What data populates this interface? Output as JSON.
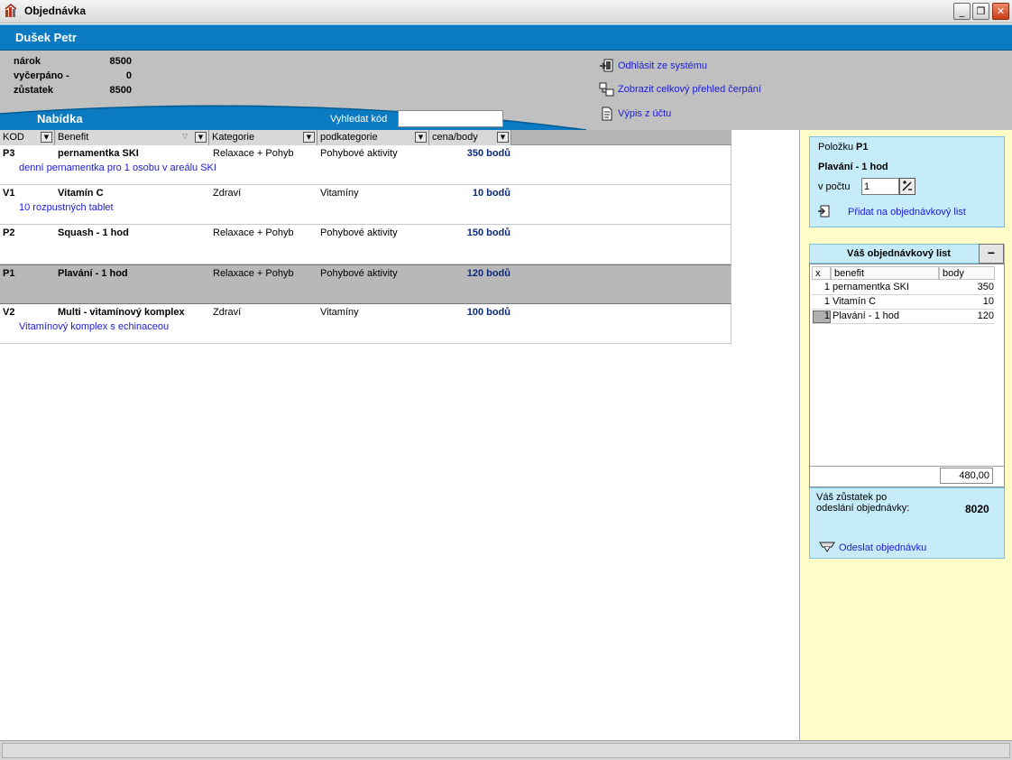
{
  "window": {
    "title": "Objednávka",
    "min": "_",
    "max": "❐",
    "close": "✕"
  },
  "user": {
    "name": "Dušek Petr"
  },
  "stats": [
    {
      "label": "nárok",
      "value": "8500"
    },
    {
      "label": "vyčerpáno  -",
      "value": "0"
    },
    {
      "label": "zůstatek",
      "value": "8500"
    }
  ],
  "actions": [
    {
      "label": "Odhlásit ze systému",
      "icon": "logout-icon"
    },
    {
      "label": "Zobrazit celkový přehled čerpání",
      "icon": "overview-icon"
    },
    {
      "label": "Výpis z účtu",
      "icon": "document-icon"
    }
  ],
  "offer": {
    "title": "Nabídka",
    "search_label": "Vyhledat kód",
    "search_value": ""
  },
  "grid": {
    "columns": [
      "KOD",
      "Benefit",
      "Kategorie",
      "podkategorie",
      "cena/body"
    ],
    "rows": [
      {
        "kod": "P3",
        "name": "pernamentka SKI",
        "kategorie": "Relaxace + Pohyb",
        "podkategorie": "Pohybové aktivity",
        "cena": "350 bodů",
        "desc": "denní pernamentka pro 1 osobu v areálu SKI",
        "selected": false
      },
      {
        "kod": "V1",
        "name": "Vitamín C",
        "kategorie": "Zdraví",
        "podkategorie": "Vitamíny",
        "cena": "10 bodů",
        "desc": "10  rozpustných tablet",
        "selected": false
      },
      {
        "kod": "P2",
        "name": "Squash - 1 hod",
        "kategorie": "Relaxace + Pohyb",
        "podkategorie": "Pohybové aktivity",
        "cena": "150 bodů",
        "desc": "",
        "selected": false
      },
      {
        "kod": "P1",
        "name": "Plavání - 1 hod",
        "kategorie": "Relaxace + Pohyb",
        "podkategorie": "Pohybové aktivity",
        "cena": "120 bodů",
        "desc": "",
        "selected": true
      },
      {
        "kod": "V2",
        "name": "Multi - vitamínový komplex",
        "kategorie": "Zdraví",
        "podkategorie": "Vitamíny",
        "cena": "100 bodů",
        "desc": "Vitamínový komplex s echinaceou",
        "selected": false
      }
    ]
  },
  "item_panel": {
    "label": "Položku",
    "code": "P1",
    "name": "Plavání - 1 hod",
    "qty_label": "v počtu",
    "qty_value": "1",
    "add_label": "Přidat na objednávkový list"
  },
  "order": {
    "title": "Váš objednávkový list",
    "minus": "−",
    "headers": [
      "x",
      "benefit",
      "body"
    ],
    "rows": [
      {
        "q": "1",
        "b": "pernamentka SKI",
        "p": "350"
      },
      {
        "q": "1",
        "b": "Vitamín C",
        "p": "10"
      },
      {
        "q": "1",
        "b": "Plavání - 1 hod",
        "p": "120"
      }
    ],
    "total": "480,00",
    "balance_label_1": "Váš zůstatek po",
    "balance_label_2": "odeslání objednávky:",
    "balance_value": "8020",
    "send_label": "Odeslat objednávku"
  },
  "colors": {
    "header_blue": "#0a7bc2",
    "panel_blue": "#c6ecfa",
    "panel_yellow": "#fffcc8",
    "link": "#1a1ad8"
  }
}
